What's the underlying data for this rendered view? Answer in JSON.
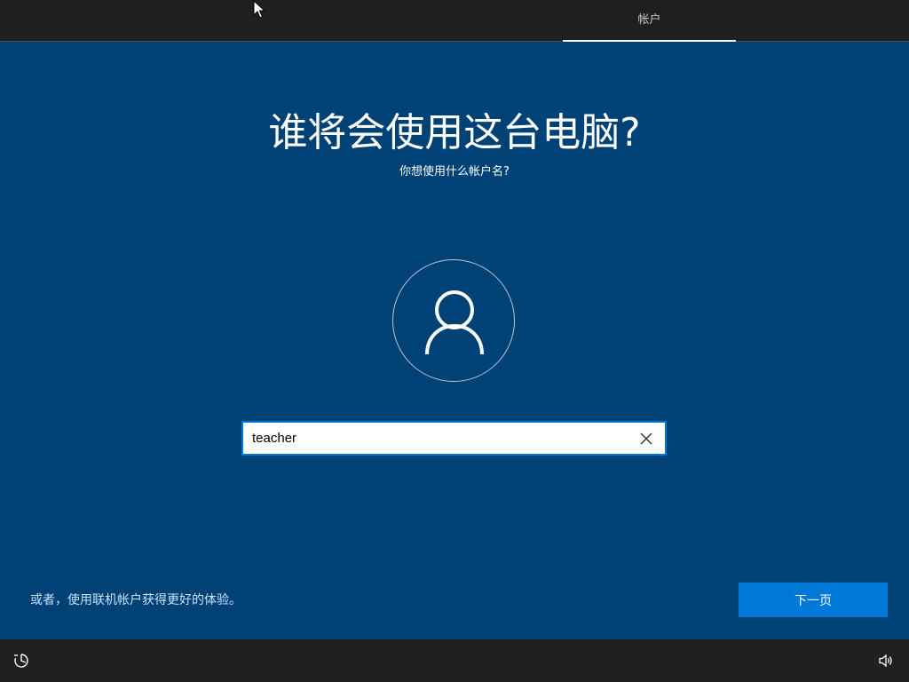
{
  "header": {
    "active_tab_label": "帐户"
  },
  "main": {
    "title": "谁将会使用这台电脑?",
    "subtitle": "你想使用什么帐户名?",
    "avatar_icon": "user-icon",
    "username_input": {
      "value": "teacher",
      "clear_icon": "close-icon"
    }
  },
  "footer": {
    "online_account_link": "或者，使用联机帐户获得更好的体验。",
    "next_button_label": "下一页"
  },
  "bottom_bar": {
    "left_icon": "accessibility-icon",
    "right_icon": "volume-icon"
  },
  "colors": {
    "background": "#004275",
    "bar": "#1f1f1f",
    "accent": "#0078d7",
    "link": "#c9e4ff"
  }
}
